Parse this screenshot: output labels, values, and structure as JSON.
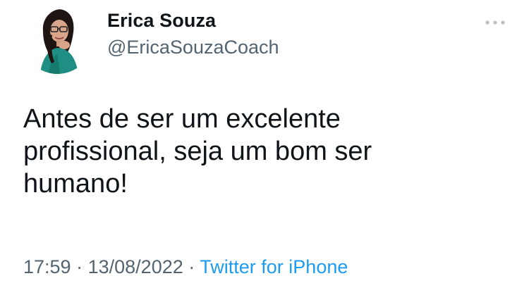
{
  "author": {
    "display_name": "Erica Souza",
    "handle": "@EricaSouzaCoach",
    "avatar_icon": "profile-photo"
  },
  "more_icon": "ellipsis-icon",
  "tweet": {
    "text_lines": [
      "Antes de ser um excelente",
      "profissional, seja um bom ser",
      "humano!"
    ],
    "time": "17:59",
    "separator": "·",
    "date": "13/08/2022",
    "source": "Twitter for iPhone"
  },
  "colors": {
    "text_primary": "#0f1419",
    "text_secondary": "#536471",
    "link": "#1d9bf0"
  }
}
